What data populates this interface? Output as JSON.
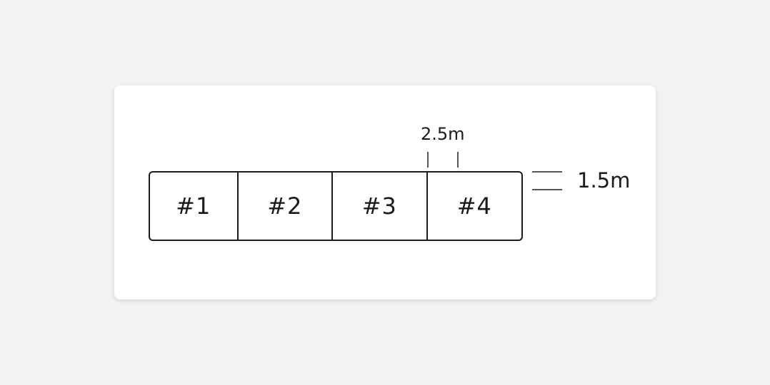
{
  "spaces": [
    {
      "label": "#1"
    },
    {
      "label": "#2"
    },
    {
      "label": "#3"
    },
    {
      "label": "#4"
    }
  ],
  "dimensions": {
    "width_label": "2.5m",
    "height_label": "1.5m"
  }
}
